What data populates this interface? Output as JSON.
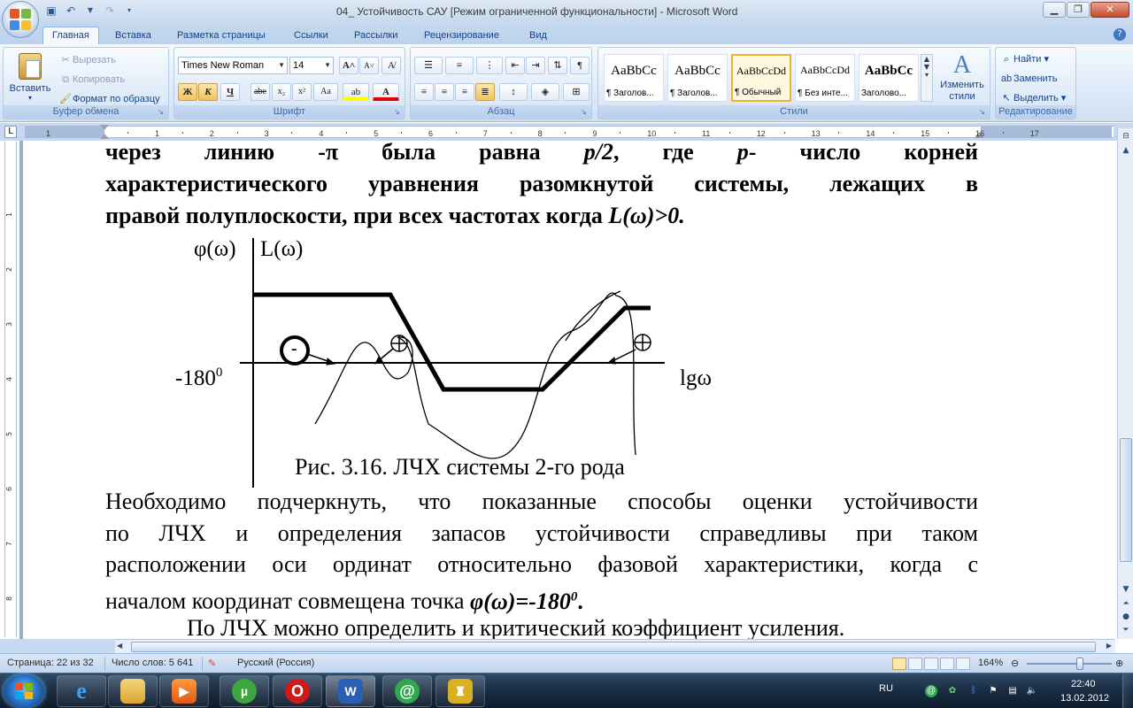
{
  "window": {
    "title": "04_ Устойчивость САУ [Режим ограниченной функциональности] - Microsoft Word"
  },
  "tabs": [
    "Главная",
    "Вставка",
    "Разметка страницы",
    "Ссылки",
    "Рассылки",
    "Рецензирование",
    "Вид"
  ],
  "ribbon": {
    "clipboard": {
      "paste": "Вставить",
      "cut": "Вырезать",
      "copy": "Копировать",
      "format_painter": "Формат по образцу",
      "name": "Буфер обмена"
    },
    "font": {
      "family": "Times New Roman",
      "size": "14",
      "name": "Шрифт",
      "bold": "Ж",
      "italic": "К",
      "underline": "Ч",
      "strike": "abe",
      "subscript": "x₂",
      "superscript": "x²",
      "case": "Aa",
      "grow": "A",
      "shrink": "A"
    },
    "paragraph": {
      "name": "Абзац",
      "pilcrow": "¶"
    },
    "styles": {
      "name": "Стили",
      "items": [
        {
          "sample": "AaBbCc",
          "label": "¶ Заголов..."
        },
        {
          "sample": "AaBbCc",
          "label": "¶ Заголов..."
        },
        {
          "sample": "AaBbCcDd",
          "label": "¶ Обычный"
        },
        {
          "sample": "AaBbCcDd",
          "label": "¶ Без инте..."
        },
        {
          "sample": "AaBbCc",
          "label": "Заголово..."
        }
      ],
      "change": "Изменить стили"
    },
    "editing": {
      "name": "Редактирование",
      "find": "Найти",
      "replace": "Заменить",
      "select": "Выделить"
    }
  },
  "ruler": {
    "left_ticks": [
      "1"
    ],
    "ticks": [
      "1",
      "2",
      "3",
      "4",
      "5",
      "6",
      "7",
      "8",
      "9",
      "10",
      "11",
      "12",
      "13",
      "14",
      "15",
      "16",
      "17"
    ],
    "vticks": [
      "1",
      "2",
      "3",
      "4",
      "5",
      "6",
      "7",
      "8",
      "9"
    ],
    "corner": "L"
  },
  "document": {
    "line1": "через линию -π была равна p/2, где p- число корней",
    "line2": "характеристического уравнения разомкнутой системы, лежащих в",
    "line3_pre": "правой полуплоскости, при всех частотах когда ",
    "line3_em": "L(ω)>0.",
    "figure": {
      "ylabel_phi": "φ(ω)",
      "ylabel_L": "L(ω)",
      "level_label": "-180",
      "level_sup": "0",
      "xlabel": "lgω",
      "minus_sign": "-",
      "caption": "Рис. 3.16. ЛЧХ системы 2-го рода"
    },
    "para2": [
      "Необходимо подчеркнуть, что показанные способы оценки устойчивости",
      "по ЛЧХ и определения запасов устойчивости справедливы при таком",
      "расположении оси ординат относительно фазовой характеристики, когда с"
    ],
    "para2_last_pre": "началом координат совмещена точка ",
    "para2_last_em": "φ(ω)=-180",
    "para2_last_sup": "0",
    "para2_last_post": ".",
    "para3": "По ЛЧХ можно определить и критический коэффициент усиления."
  },
  "status": {
    "page": "Страница: 22 из 32",
    "words": "Число слов: 5 641",
    "language": "Русский (Россия)",
    "zoom": "164%",
    "zoom_level": 0.62
  },
  "taskbar": {
    "lang": "RU",
    "time": "22:40",
    "date": "13.02.2012",
    "apps": [
      "ie-icon",
      "explorer-icon",
      "media-player-icon",
      "utorrent-icon",
      "opera-icon",
      "word-icon",
      "mail-agent-icon",
      "game-icon"
    ]
  },
  "colors": {
    "ribbon_accent": "#15428b",
    "taskbar": "#1a2c42"
  }
}
